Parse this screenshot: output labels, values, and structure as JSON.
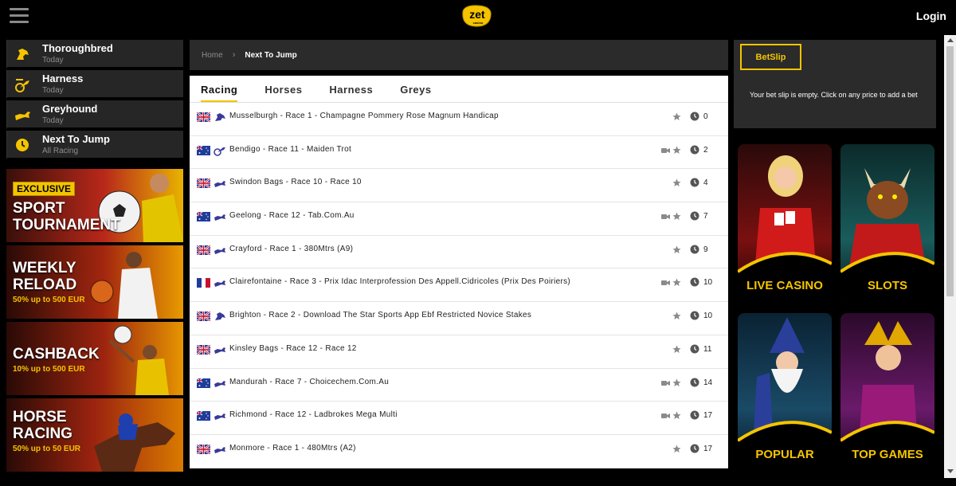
{
  "header": {
    "logo_text": "zet",
    "logo_sub": "casino",
    "login_label": "Login"
  },
  "sidebar": {
    "items": [
      {
        "title": "Thoroughbred",
        "sub": "Today"
      },
      {
        "title": "Harness",
        "sub": "Today"
      },
      {
        "title": "Greyhound",
        "sub": "Today"
      },
      {
        "title": "Next To Jump",
        "sub": "All Racing"
      }
    ],
    "promos": [
      {
        "badge": "EXCLUSIVE",
        "title_line1": "SPORT",
        "title_line2": "TOURNAMENT",
        "sub": ""
      },
      {
        "badge": "",
        "title_line1": "WEEKLY",
        "title_line2": "RELOAD",
        "sub": "50% up to 500 EUR"
      },
      {
        "badge": "",
        "title_line1": "CASHBACK",
        "title_line2": "",
        "sub": "10% up to 500 EUR"
      },
      {
        "badge": "",
        "title_line1": "HORSE",
        "title_line2": "RACING",
        "sub": "50% up to 50 EUR"
      }
    ]
  },
  "breadcrumb": {
    "home": "Home",
    "separator": "›",
    "current": "Next To Jump"
  },
  "tabs": [
    {
      "label": "Racing"
    },
    {
      "label": "Horses"
    },
    {
      "label": "Harness"
    },
    {
      "label": "Greys"
    }
  ],
  "races": [
    {
      "flag": "uk",
      "type": "horse",
      "name": "Musselburgh - Race 1 - Champagne Pommery Rose Magnum Handicap",
      "video": false,
      "mins": "0"
    },
    {
      "flag": "au",
      "type": "harness",
      "name": "Bendigo - Race 11 - Maiden Trot",
      "video": true,
      "mins": "2"
    },
    {
      "flag": "uk",
      "type": "greyhound",
      "name": "Swindon Bags - Race 10 - Race 10",
      "video": false,
      "mins": "4"
    },
    {
      "flag": "au",
      "type": "greyhound",
      "name": "Geelong - Race 12 - Tab.Com.Au",
      "video": true,
      "mins": "7"
    },
    {
      "flag": "uk",
      "type": "greyhound",
      "name": "Crayford - Race 1 - 380Mtrs (A9)",
      "video": false,
      "mins": "9"
    },
    {
      "flag": "fr",
      "type": "greyhound",
      "name": "Clairefontaine - Race 3 - Prix Idac Interprofession Des Appell.Cidricoles (Prix Des Poiriers)",
      "video": true,
      "mins": "10"
    },
    {
      "flag": "uk",
      "type": "horse",
      "name": "Brighton - Race 2 - Download The Star Sports App Ebf Restricted Novice Stakes",
      "video": false,
      "mins": "10"
    },
    {
      "flag": "uk",
      "type": "greyhound",
      "name": "Kinsley Bags - Race 12 - Race 12",
      "video": false,
      "mins": "11"
    },
    {
      "flag": "au",
      "type": "greyhound",
      "name": "Mandurah - Race 7 - Choicechem.Com.Au",
      "video": true,
      "mins": "14"
    },
    {
      "flag": "au",
      "type": "greyhound",
      "name": "Richmond - Race 12 - Ladbrokes Mega Multi",
      "video": true,
      "mins": "17"
    },
    {
      "flag": "uk",
      "type": "greyhound",
      "name": "Monmore - Race 1 - 480Mtrs (A2)",
      "video": false,
      "mins": "17"
    }
  ],
  "betslip": {
    "button_label": "BetSlip",
    "empty_message": "Your bet slip is empty. Click on any price to add a bet"
  },
  "categories": [
    {
      "label": "LIVE CASINO"
    },
    {
      "label": "SLOTS"
    },
    {
      "label": "POPULAR"
    },
    {
      "label": "TOP GAMES"
    }
  ],
  "colors": {
    "accent": "#f5c400",
    "panel": "#2b2b2b",
    "background": "#000000"
  }
}
